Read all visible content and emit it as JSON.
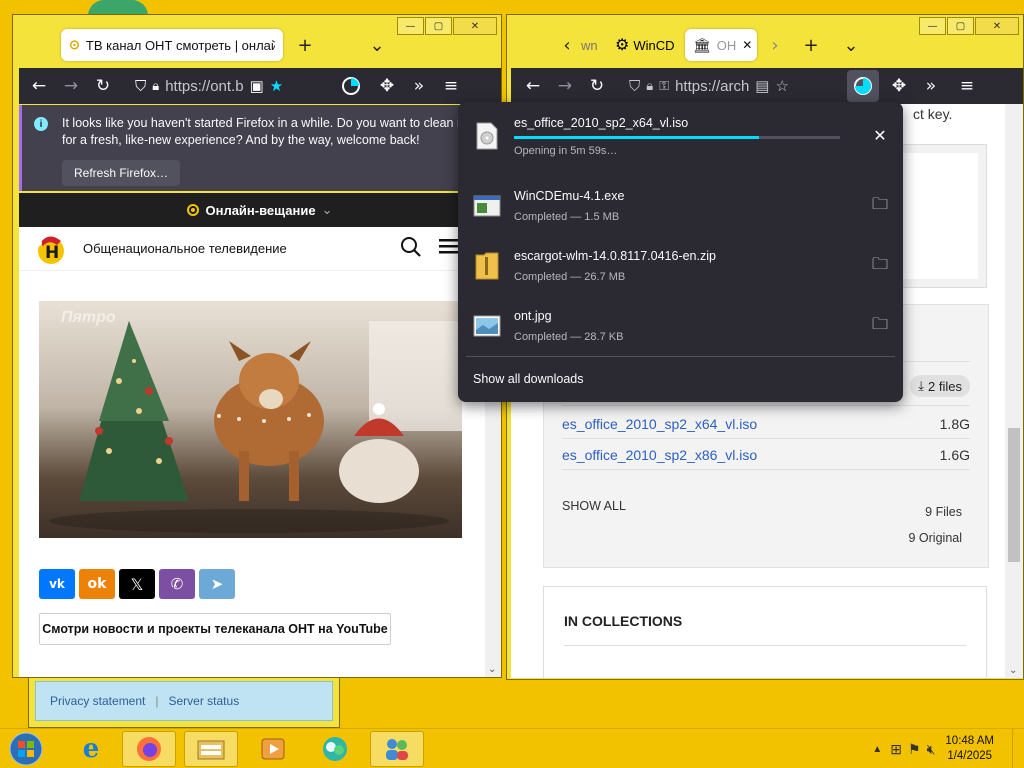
{
  "left_window": {
    "tab_title": "ТВ канал ОНТ смотреть | онлайн",
    "url": "https://ont.b",
    "infobar_text": "It looks like you haven't started Firefox in a while. Do you want to clean it up for a fresh, like-new experience? And by the way, welcome back!",
    "refresh_button": "Refresh Firefox…",
    "live_label": "Онлайн-вещание",
    "site_title": "Общенациональное телевидение",
    "image_watermark": "Пятро",
    "social": [
      "ВК",
      "ОК",
      "X",
      "Viber",
      "Telegram"
    ],
    "youtube_button": "Смотри новости и проекты телеканала ОНТ на YouTube"
  },
  "right_window": {
    "tabs": [
      "wn",
      "WinCD",
      "OH"
    ],
    "url": "https://arch",
    "page_snippet": "ct key.",
    "files_badge": "2 files",
    "files": [
      {
        "name": "es_office_2010_sp2_x64_vl.iso",
        "size": "1.8G"
      },
      {
        "name": "es_office_2010_sp2_x86_vl.iso",
        "size": "1.6G"
      }
    ],
    "show_all": "SHOW ALL",
    "file_count": "9 Files",
    "original_count": "9 Original",
    "collections_heading": "IN COLLECTIONS"
  },
  "downloads": {
    "items": [
      {
        "name": "es_office_2010_sp2_x64_vl.iso",
        "status": "Opening in 5m 59s…",
        "progress": 0.75,
        "action": "cancel"
      },
      {
        "name": "WinCDEmu-4.1.exe",
        "status": "Completed — 1.5 MB",
        "action": "folder"
      },
      {
        "name": "escargot-wlm-14.0.8117.0416-en.zip",
        "status": "Completed — 26.7 MB",
        "action": "folder"
      },
      {
        "name": "ont.jpg",
        "status": "Completed — 28.7 KB",
        "action": "folder"
      }
    ],
    "show_all": "Show all downloads"
  },
  "background_panel": {
    "privacy": "Privacy statement",
    "server_status": "Server status"
  },
  "taskbar": {
    "time": "10:48 AM",
    "date": "1/4/2025"
  },
  "colors": {
    "desktop": "#f2c200",
    "firefox_dark": "#2b2a33",
    "progress": "#00ddff",
    "link": "#2c5fbf"
  }
}
